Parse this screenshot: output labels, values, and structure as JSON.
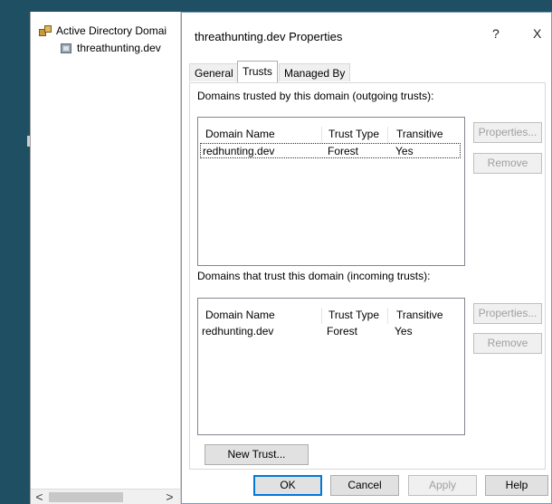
{
  "tree": {
    "root_label": "Active Directory Domai",
    "domain_label": "threathunting.dev",
    "scroll_left": "<",
    "scroll_right": ">"
  },
  "dialog": {
    "title": "threathunting.dev Properties",
    "help_glyph": "?",
    "close_glyph": "X",
    "tabs": [
      {
        "label": "General",
        "active": false
      },
      {
        "label": "Trusts",
        "active": true
      },
      {
        "label": "Managed By",
        "active": false
      }
    ],
    "outgoing": {
      "label": "Domains trusted by this domain (outgoing trusts):",
      "columns": [
        "Domain Name",
        "Trust Type",
        "Transitive"
      ],
      "rows": [
        {
          "domain": "redhunting.dev",
          "type": "Forest",
          "transitive": "Yes"
        }
      ],
      "properties_label": "Properties...",
      "remove_label": "Remove"
    },
    "incoming": {
      "label": "Domains that trust this domain (incoming trusts):",
      "columns": [
        "Domain Name",
        "Trust Type",
        "Transitive"
      ],
      "rows": [
        {
          "domain": "redhunting.dev",
          "type": "Forest",
          "transitive": "Yes"
        }
      ],
      "properties_label": "Properties...",
      "remove_label": "Remove"
    },
    "new_trust_label": "New Trust...",
    "buttons": {
      "ok": "OK",
      "cancel": "Cancel",
      "apply": "Apply",
      "help": "Help"
    }
  }
}
